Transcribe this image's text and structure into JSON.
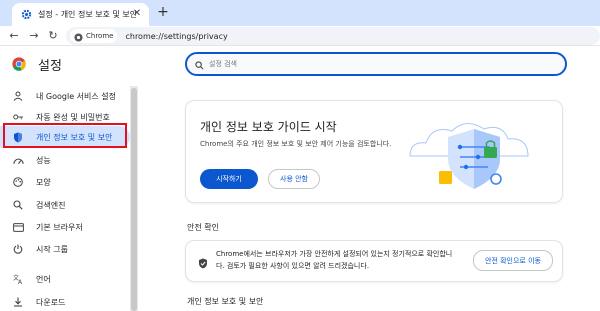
{
  "browser": {
    "tab_title": "설정 - 개인 정보 보호 및 보안",
    "chip_label": "Chrome",
    "url": "chrome://settings/privacy"
  },
  "header": {
    "title": "설정",
    "search_placeholder": "설정 검색"
  },
  "sidebar": {
    "items": [
      {
        "label": "내 Google 서비스 설정",
        "icon": "person-icon"
      },
      {
        "label": "자동 완성 및 비밀번호",
        "icon": "key-icon"
      },
      {
        "label": "개인 정보 보호 및 보안",
        "icon": "shield-icon",
        "active": true
      },
      {
        "label": "성능",
        "icon": "speed-icon"
      },
      {
        "label": "모양",
        "icon": "palette-icon"
      },
      {
        "label": "검색엔진",
        "icon": "search-icon"
      },
      {
        "label": "기본 브라우저",
        "icon": "browser-icon"
      },
      {
        "label": "시작 그룹",
        "icon": "power-icon"
      },
      {
        "label": "언어",
        "icon": "translate-icon"
      },
      {
        "label": "다운로드",
        "icon": "download-icon"
      }
    ]
  },
  "main": {
    "guide": {
      "title": "개인 정보 보호 가이드 시작",
      "description": "Chrome의 주요 개인 정보 보호 및 보안 제어 기능을 검토합니다.",
      "primary_button": "시작하기",
      "secondary_button": "사용 안함"
    },
    "safety_check": {
      "section_title": "안전 확인",
      "text": "Chrome에서는 브라우저가 가장 안전하게 설정되어 있는지 정기적으로 확인합니다. 검토가 필요한 사항이 있으면 알려 드리겠습니다.",
      "button": "안전 확인으로 이동"
    },
    "privacy_section_title": "개인 정보 보호 및 보안"
  },
  "colors": {
    "accent": "#0b57d0",
    "active_bg": "#d3e3fd",
    "highlight": "#e3101e"
  }
}
